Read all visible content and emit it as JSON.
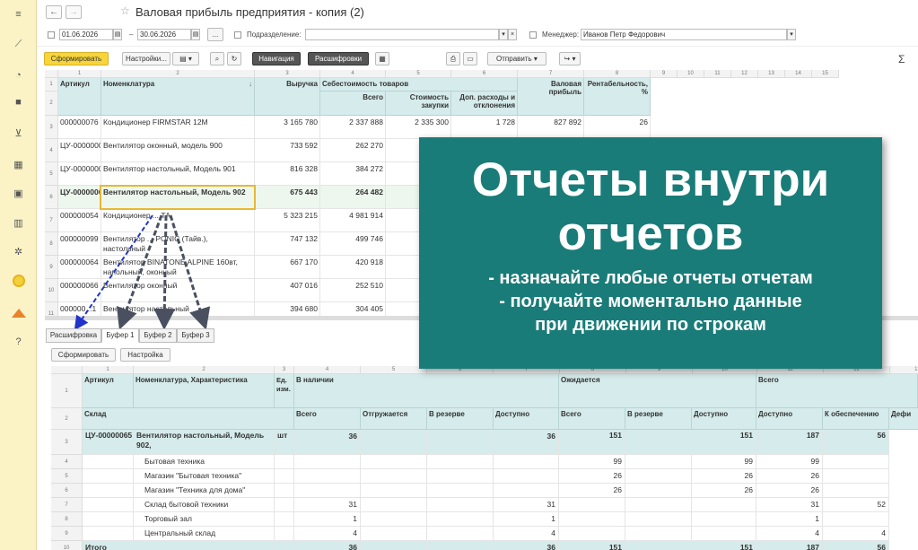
{
  "window": {
    "title": "Валовая прибыль предприятия - копия (2)"
  },
  "filters": {
    "date_from": "01.06.2026",
    "date_to": "30.06.2026",
    "ellipsis": "...",
    "podr_label": "Подразделение:",
    "manager_label": "Менеджер:",
    "manager_value": "Иванов Петр Федорович"
  },
  "toolbar": {
    "form": "Сформировать",
    "settings": "Настройки...",
    "nav": "Навигация",
    "decode": "Расшифровки",
    "send": "Отправить",
    "sigma": "Σ"
  },
  "grid1": {
    "col_numbers": [
      "1",
      "2",
      "3",
      "4",
      "5",
      "6",
      "7",
      "8",
      "9",
      "10",
      "11",
      "12",
      "13",
      "14",
      "15",
      "16"
    ],
    "headers": {
      "article": "Артикул",
      "nomenclature": "Номенклатура",
      "revenue": "Выручка",
      "cost": "Себестоимость товаров",
      "total": "Всего",
      "purchase": "Стоимость закупки",
      "extra": "Доп. расходы и отклонения",
      "gross": "Валовая прибыль",
      "profitability": "Рентабельность, %"
    },
    "rows": [
      {
        "n": "3",
        "article": "000000076",
        "name": "Кондиционер FIRMSTAR 12M",
        "revenue": "3 165 780",
        "total": "2 337 888",
        "purchase": "2 335 300",
        "extra": "1 728",
        "gross": "827 892",
        "profit": "26"
      },
      {
        "n": "4",
        "article": "ЦУ-00000009",
        "name": "Вентилятор оконный, модель 900",
        "revenue": "733 592",
        "total": "262 270",
        "purchase": "",
        "extra": "",
        "gross": "",
        "profit": ""
      },
      {
        "n": "5",
        "article": "ЦУ-00000008",
        "name": "Вентилятор настольный, Модель 901",
        "revenue": "816 328",
        "total": "384 272",
        "purchase": "",
        "extra": "",
        "gross": "",
        "profit": ""
      },
      {
        "n": "6",
        "article": "ЦУ-00000065",
        "name": "Вентилятор настольный, Модель 902",
        "revenue": "675 443",
        "total": "264 482",
        "purchase": "",
        "extra": "",
        "gross": "",
        "profit": ""
      },
      {
        "n": "7",
        "article": "000000054",
        "name": "Кондиционер ... ТА",
        "revenue": "5 323 215",
        "total": "4 981 914",
        "purchase": "4",
        "extra": "",
        "gross": "",
        "profit": ""
      },
      {
        "n": "8",
        "article": "000000099",
        "name": "Вентилятор ... PONIC (Тайв.), настольный",
        "revenue": "747 132",
        "total": "499 746",
        "purchase": "",
        "extra": "",
        "gross": "",
        "profit": ""
      },
      {
        "n": "9",
        "article": "000000064",
        "name": "Вентилятор BINATONE ALPINE 160вт, напольный, оконный",
        "revenue": "667 170",
        "total": "420 918",
        "purchase": "",
        "extra": "",
        "gross": "",
        "profit": ""
      },
      {
        "n": "10",
        "article": "000000066",
        "name": "Вентилятор оконный",
        "revenue": "407 016",
        "total": "252 510",
        "purchase": "",
        "extra": "",
        "gross": "",
        "profit": ""
      },
      {
        "n": "11",
        "article": "000000...1",
        "name": "Вентилятор настольный",
        "revenue": "394 680",
        "total": "304 405",
        "purchase": "",
        "extra": "",
        "gross": "",
        "profit": ""
      }
    ]
  },
  "tabs": [
    "Расшифровка",
    "Буфер 1",
    "Буфер 2",
    "Буфер 3"
  ],
  "grid2toolbar": {
    "form": "Сформировать",
    "settings": "Настройка"
  },
  "grid2": {
    "col_numbers": [
      "1",
      "2",
      "3",
      "4",
      "5",
      "6",
      "7",
      "8",
      "9",
      "10",
      "11",
      "12",
      "13"
    ],
    "headers": {
      "article": "Артикул",
      "nomen": "Номенклатура, Характеристика",
      "unit": "Ед. изм.",
      "in_stock": "В наличии",
      "expected": "Ожидается",
      "all": "Всего",
      "warehouse": "Склад",
      "total": "Всего",
      "shipping": "Отгружается",
      "reserve": "В резерве",
      "available": "Доступно",
      "e_total": "Всего",
      "e_reserve": "В резерве",
      "e_available": "Доступно",
      "a_available": "Доступно",
      "a_provide": "К обеспечению",
      "a_deficit": "Дефи"
    },
    "rows": [
      {
        "n": "3",
        "article": "ЦУ-00000065",
        "name": "Вентилятор настольный, Модель 902,",
        "unit": "шт",
        "total": "36",
        "ship": "",
        "res": "",
        "avail": "36",
        "etotal": "151",
        "eres": "",
        "eavail": "151",
        "aavail": "187",
        "aprov": "56",
        "bold": true
      },
      {
        "n": "4",
        "article": "",
        "name": "Бытовая техника",
        "unit": "",
        "total": "",
        "ship": "",
        "res": "",
        "avail": "",
        "etotal": "99",
        "eres": "",
        "eavail": "99",
        "aavail": "99",
        "aprov": ""
      },
      {
        "n": "5",
        "article": "",
        "name": "Магазин \"Бытовая техника\"",
        "unit": "",
        "total": "",
        "ship": "",
        "res": "",
        "avail": "",
        "etotal": "26",
        "eres": "",
        "eavail": "26",
        "aavail": "26",
        "aprov": ""
      },
      {
        "n": "6",
        "article": "",
        "name": "Магазин \"Техника для дома\"",
        "unit": "",
        "total": "",
        "ship": "",
        "res": "",
        "avail": "",
        "etotal": "26",
        "eres": "",
        "eavail": "26",
        "aavail": "26",
        "aprov": ""
      },
      {
        "n": "7",
        "article": "",
        "name": "Склад бытовой техники",
        "unit": "",
        "total": "31",
        "ship": "",
        "res": "",
        "avail": "31",
        "etotal": "",
        "eres": "",
        "eavail": "",
        "aavail": "31",
        "aprov": "52"
      },
      {
        "n": "8",
        "article": "",
        "name": "Торговый зал",
        "unit": "",
        "total": "1",
        "ship": "",
        "res": "",
        "avail": "1",
        "etotal": "",
        "eres": "",
        "eavail": "",
        "aavail": "1",
        "aprov": ""
      },
      {
        "n": "9",
        "article": "",
        "name": "Центральный склад",
        "unit": "",
        "total": "4",
        "ship": "",
        "res": "",
        "avail": "4",
        "etotal": "",
        "eres": "",
        "eavail": "",
        "aavail": "4",
        "aprov": "4"
      },
      {
        "n": "10",
        "article": "Итого",
        "name": "",
        "unit": "",
        "total": "36",
        "ship": "",
        "res": "",
        "avail": "36",
        "etotal": "151",
        "eres": "",
        "eavail": "151",
        "aavail": "187",
        "aprov": "56",
        "bold": true
      }
    ]
  },
  "banner": {
    "title1": "Отчеты внутри",
    "title2": "отчетов",
    "line1": "- назначайте любые отчеты отчетам",
    "line2": "- получайте моментально данные",
    "line3": "при движении по строкам"
  }
}
